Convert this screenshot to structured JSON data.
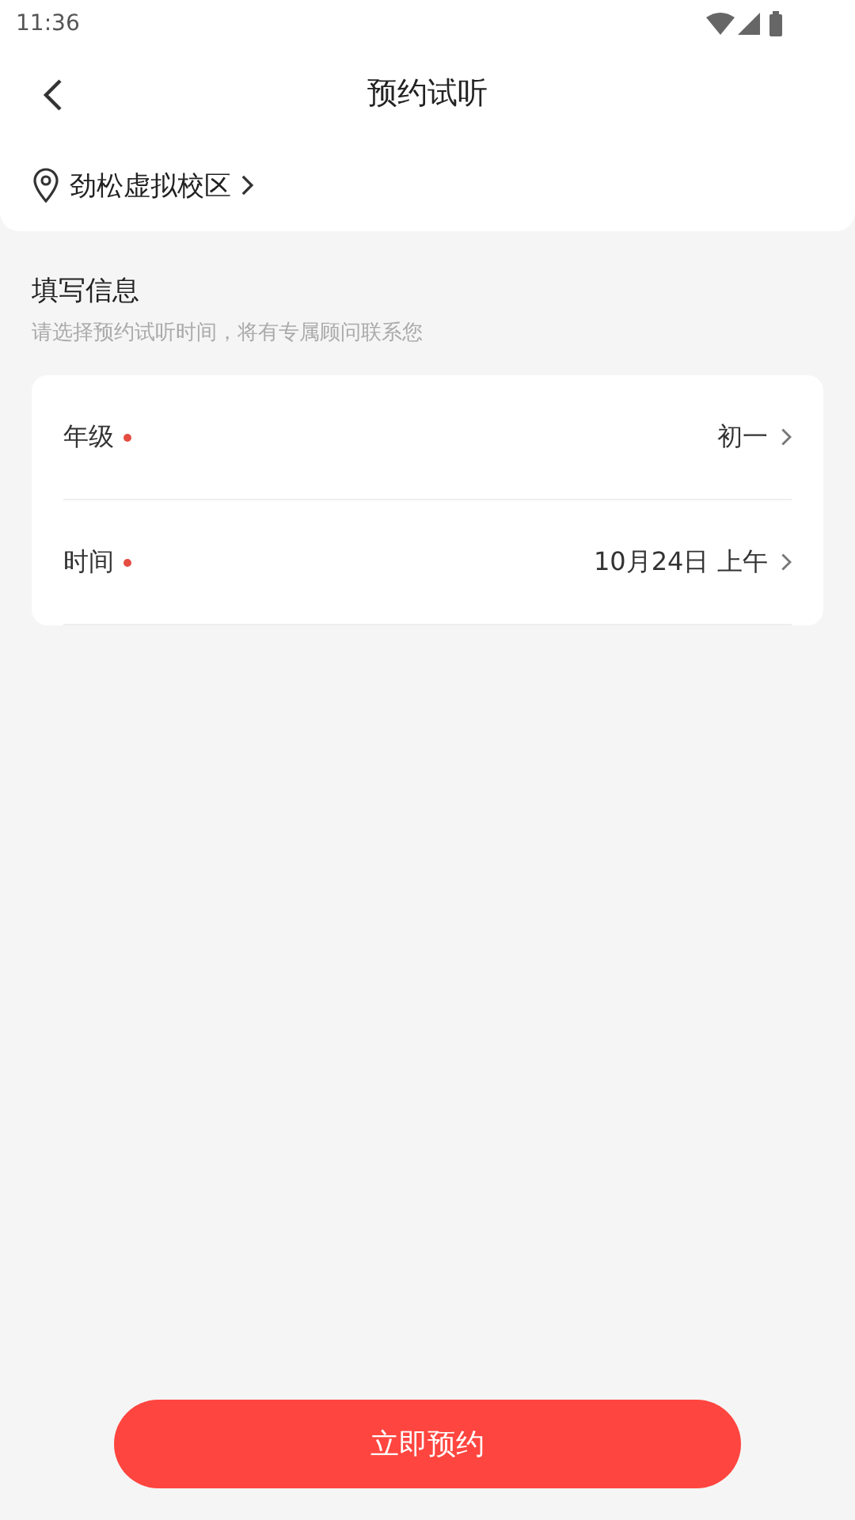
{
  "status_bar": {
    "time": "11:36"
  },
  "header": {
    "title": "预约试听"
  },
  "campus": {
    "name": "劲松虚拟校区"
  },
  "section": {
    "title": "填写信息",
    "subtitle": "请选择预约试听时间，将有专属顾问联系您"
  },
  "fields": [
    {
      "label": "年级",
      "required": true,
      "value": "初一"
    },
    {
      "label": "时间",
      "required": true,
      "value": "10月24日 上午"
    }
  ],
  "submit_button": "立即预约"
}
